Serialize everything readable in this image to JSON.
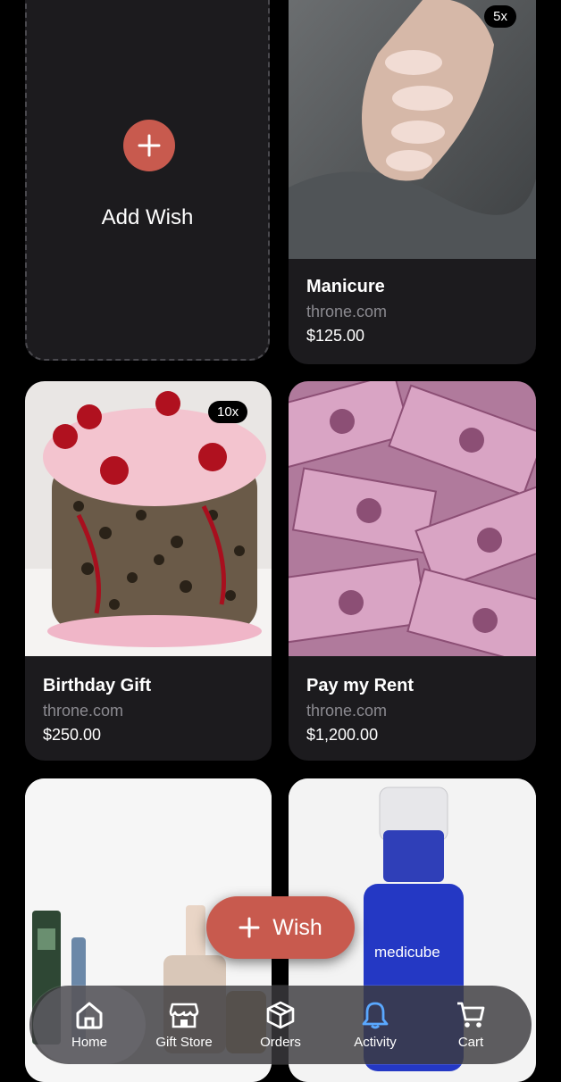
{
  "add_card": {
    "label": "Add Wish"
  },
  "wishes": [
    {
      "title": "Manicure",
      "source": "throne.com",
      "price": "$125.00",
      "badge": "5x"
    },
    {
      "title": "Birthday Gift",
      "source": "throne.com",
      "price": "$250.00",
      "badge": "10x"
    },
    {
      "title": "Pay my Rent",
      "source": "throne.com",
      "price": "$1,200.00",
      "badge": ""
    },
    {
      "title": "",
      "source": "",
      "price": "",
      "badge": ""
    },
    {
      "title": "",
      "source": "",
      "price": "",
      "badge": "",
      "product_text": "medicube"
    }
  ],
  "fab": {
    "label": "Wish"
  },
  "tabbar": {
    "items": [
      {
        "label": "Home",
        "icon": "home-icon"
      },
      {
        "label": "Gift Store",
        "icon": "store-icon"
      },
      {
        "label": "Orders",
        "icon": "box-icon"
      },
      {
        "label": "Activity",
        "icon": "bell-icon"
      },
      {
        "label": "Cart",
        "icon": "cart-icon"
      }
    ]
  },
  "colors": {
    "accent": "#c85a4e",
    "card": "#1c1b1e",
    "muted": "#8b8a90"
  }
}
